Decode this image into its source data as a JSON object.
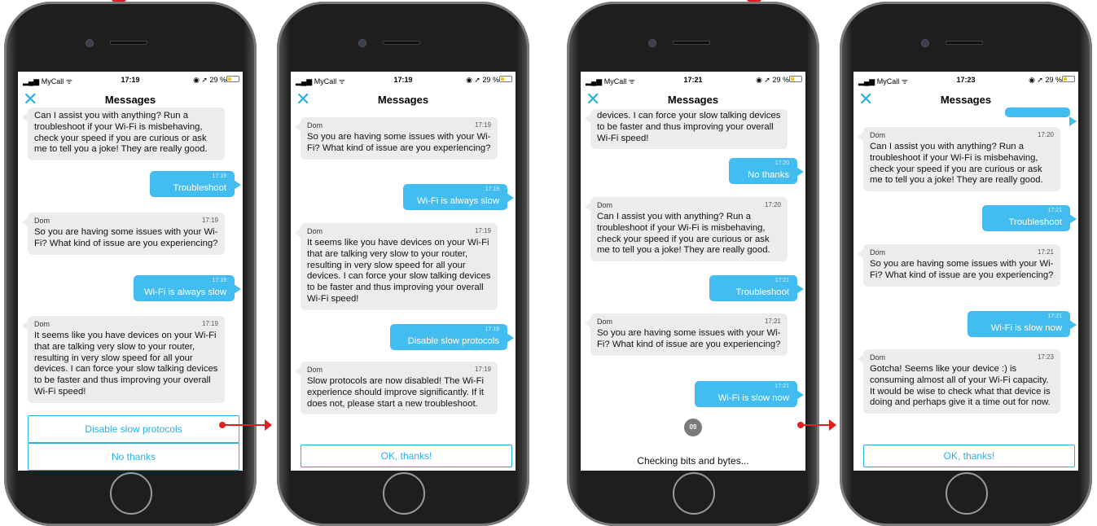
{
  "colors": {
    "accent": "#2aaee6",
    "outgoing_bubble": "#43bdef",
    "incoming_bubble": "#ececec",
    "arrow": "#e02020"
  },
  "phones": [
    {
      "status": {
        "carrier": "MyCall",
        "time": "17:19",
        "battery": "29 %"
      },
      "title": "Messages",
      "messages": [
        {
          "text": "Can I assist you with anything? Run a troubleshoot if your Wi-Fi is misbehaving, check your speed if you are curious or ask me to tell you a joke! They are really good."
        },
        {
          "time": "17:19",
          "text": "Troubleshoot"
        },
        {
          "sender": "Dom",
          "time": "17:19",
          "text": "So you are having some issues with your Wi-Fi? What kind of issue are you experiencing?"
        },
        {
          "time": "17:19",
          "text": "Wi-Fi is always slow"
        },
        {
          "sender": "Dom",
          "time": "17:19",
          "text": "It seems like you have devices on your Wi-Fi that are talking very slow to your router, resulting in very slow speed for all your devices. I can force your slow talking devices to be faster and thus improving your overall Wi-Fi speed!"
        }
      ],
      "options": [
        "Disable slow protocols",
        "No thanks"
      ]
    },
    {
      "status": {
        "carrier": "MyCall",
        "time": "17:19",
        "battery": "29 %"
      },
      "title": "Messages",
      "messages": [
        {
          "sender": "Dom",
          "time": "17:19",
          "text": "So you are having some issues with your Wi-Fi? What kind of issue are you experiencing?"
        },
        {
          "time": "17:19",
          "text": "Wi-Fi is always slow"
        },
        {
          "sender": "Dom",
          "time": "17:19",
          "text": "It seems like you have devices on your Wi-Fi that are talking very slow to your router, resulting in very slow speed for all your devices. I can force your slow talking devices to be faster and thus improving your overall Wi-Fi speed!"
        },
        {
          "time": "17:19",
          "text": "Disable slow protocols"
        },
        {
          "sender": "Dom",
          "time": "17:19",
          "text": "Slow protocols are now disabled! The Wi-Fi experience should improve significantly. If it does not, please start a new troubleshoot."
        }
      ],
      "options": [
        "OK, thanks!"
      ]
    },
    {
      "status": {
        "carrier": "MyCall",
        "time": "17:21",
        "battery": "29 %"
      },
      "title": "Messages",
      "messages": [
        {
          "text": "devices. I can force your slow talking devices to be faster and thus improving your overall Wi-Fi speed!"
        },
        {
          "time": "17:20",
          "text": "No thanks"
        },
        {
          "sender": "Dom",
          "time": "17:20",
          "text": "Can I assist you with anything? Run a troubleshoot if your Wi-Fi is misbehaving, check your speed if you are curious or ask me to tell you a joke! They are really good."
        },
        {
          "time": "17:21",
          "text": "Troubleshoot"
        },
        {
          "sender": "Dom",
          "time": "17:21",
          "text": "So you are having some issues with your Wi-Fi? What kind of issue are you experiencing?"
        },
        {
          "time": "17:21",
          "text": "Wi-Fi is slow now"
        }
      ],
      "spinner": "09",
      "checking": "Checking bits and bytes..."
    },
    {
      "status": {
        "carrier": "MyCall",
        "time": "17:23",
        "battery": "29 %"
      },
      "title": "Messages",
      "messages": [
        {
          "sender": "Dom",
          "time": "17:20",
          "text": "Can I assist you with anything? Run a troubleshoot if your Wi-Fi is misbehaving, check your speed if you are curious or ask me to tell you a joke! They are really good."
        },
        {
          "time": "17:21",
          "text": "Troubleshoot"
        },
        {
          "sender": "Dom",
          "time": "17:21",
          "text": "So you are having some issues with your Wi-Fi? What kind of issue are you experiencing?"
        },
        {
          "time": "17:21",
          "text": "Wi-Fi is slow now"
        },
        {
          "sender": "Dom",
          "time": "17:23",
          "text": "Gotcha! Seems like your device :) is consuming almost all of your Wi-Fi capacity. It would be wise to check what that device is doing and perhaps give it a time out for now."
        }
      ],
      "options": [
        "OK, thanks!"
      ]
    }
  ]
}
